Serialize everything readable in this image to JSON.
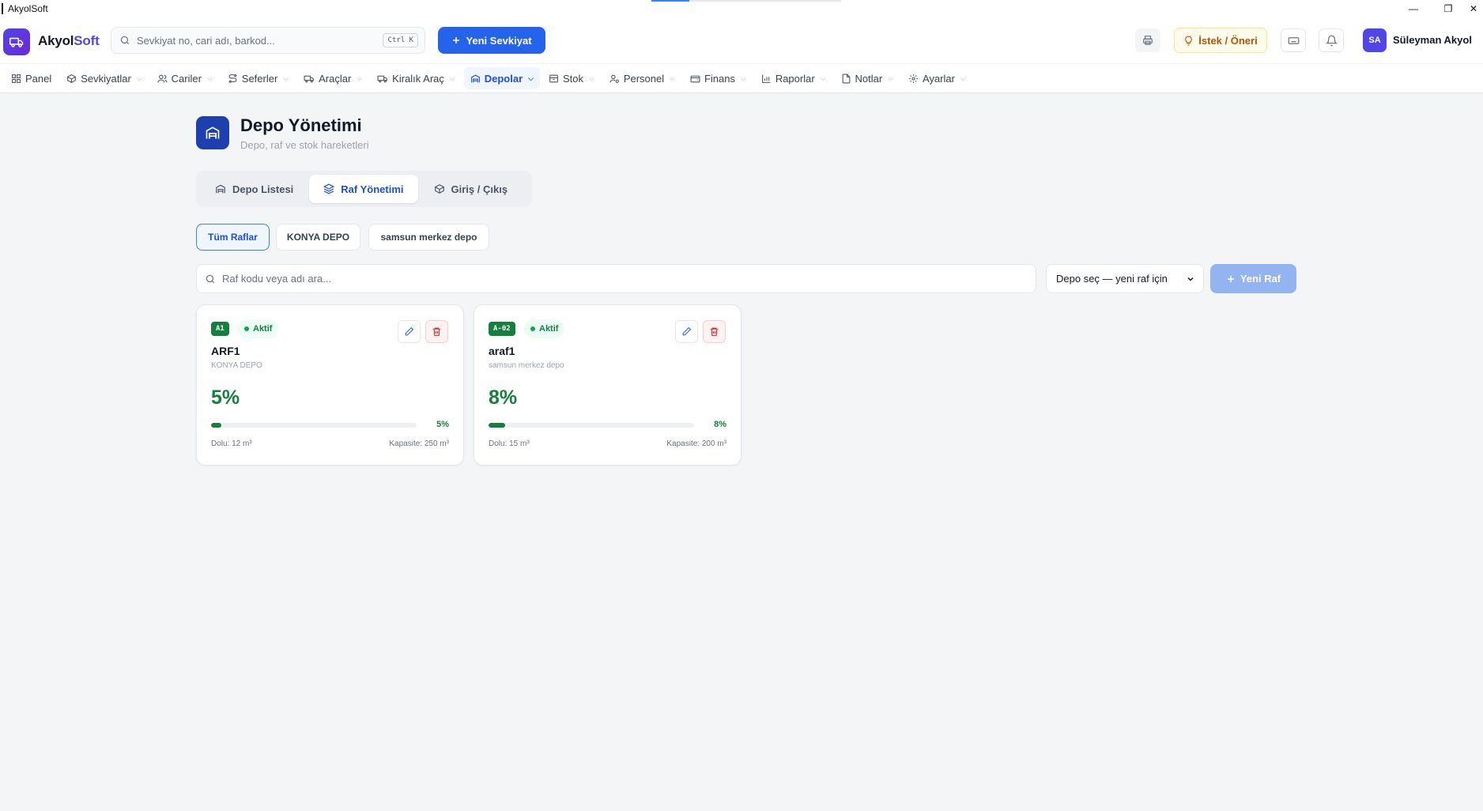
{
  "window": {
    "title": "AkyolSoft",
    "minimize": "—",
    "restore": "❐",
    "close": "✕"
  },
  "header": {
    "brand_part1": "Akyol",
    "brand_part2": "Soft",
    "search_placeholder": "Sevkiyat no, cari adı, barkod...",
    "search_shortcut": "Ctrl K",
    "new_shipment_label": "Yeni Sevkiyat",
    "suggestion_label": "İstek / Öneri",
    "user_initials": "SA",
    "user_name": "Süleyman Akyol"
  },
  "nav": {
    "items": [
      {
        "label": "Panel",
        "icon": "grid-icon",
        "dropdown": false
      },
      {
        "label": "Sevkiyatlar",
        "icon": "box-icon",
        "dropdown": true
      },
      {
        "label": "Cariler",
        "icon": "users-icon",
        "dropdown": true
      },
      {
        "label": "Seferler",
        "icon": "route-icon",
        "dropdown": true
      },
      {
        "label": "Araçlar",
        "icon": "truck-icon",
        "dropdown": true
      },
      {
        "label": "Kiralık Araç",
        "icon": "rental-truck-icon",
        "dropdown": true
      },
      {
        "label": "Depolar",
        "icon": "warehouse-icon",
        "dropdown": true,
        "active": true
      },
      {
        "label": "Stok",
        "icon": "archive-icon",
        "dropdown": true
      },
      {
        "label": "Personel",
        "icon": "user-gear-icon",
        "dropdown": true
      },
      {
        "label": "Finans",
        "icon": "wallet-icon",
        "dropdown": true
      },
      {
        "label": "Raporlar",
        "icon": "bar-chart-icon",
        "dropdown": true
      },
      {
        "label": "Notlar",
        "icon": "note-icon",
        "dropdown": true
      },
      {
        "label": "Ayarlar",
        "icon": "gear-icon",
        "dropdown": true
      }
    ]
  },
  "page": {
    "title": "Depo Yönetimi",
    "subtitle": "Depo, raf ve stok hareketleri"
  },
  "tabs": [
    {
      "label": "Depo Listesi",
      "icon": "warehouse-icon"
    },
    {
      "label": "Raf Yönetimi",
      "icon": "layers-icon",
      "active": true
    },
    {
      "label": "Giriş / Çıkış",
      "icon": "boxes-icon"
    }
  ],
  "filters": [
    {
      "label": "Tüm Raflar",
      "active": true
    },
    {
      "label": "KONYA DEPO"
    },
    {
      "label": "samsun merkez depo"
    }
  ],
  "toolbar": {
    "search_placeholder": "Raf kodu veya adı ara...",
    "depot_select_value": "Depo seç — yeni raf için",
    "new_shelf_label": "Yeni Raf"
  },
  "shelves": [
    {
      "code": "A1",
      "status": "Aktif",
      "name": "ARF1",
      "depot": "KONYA DEPO",
      "fill_percent": 5,
      "percent_label": "5%",
      "used": "Dolu: 12 m³",
      "capacity": "Kapasite: 250 m³"
    },
    {
      "code": "A-02",
      "status": "Aktif",
      "name": "araf1",
      "depot": "samsun merkez depo",
      "fill_percent": 8,
      "percent_label": "8%",
      "used": "Dolu: 15 m³",
      "capacity": "Kapasite: 200 m³"
    }
  ],
  "colors": {
    "primary": "#2563eb",
    "brand": "#4f46e5",
    "success": "#15803d",
    "danger": "#dc2626",
    "warning": "#b45309"
  }
}
